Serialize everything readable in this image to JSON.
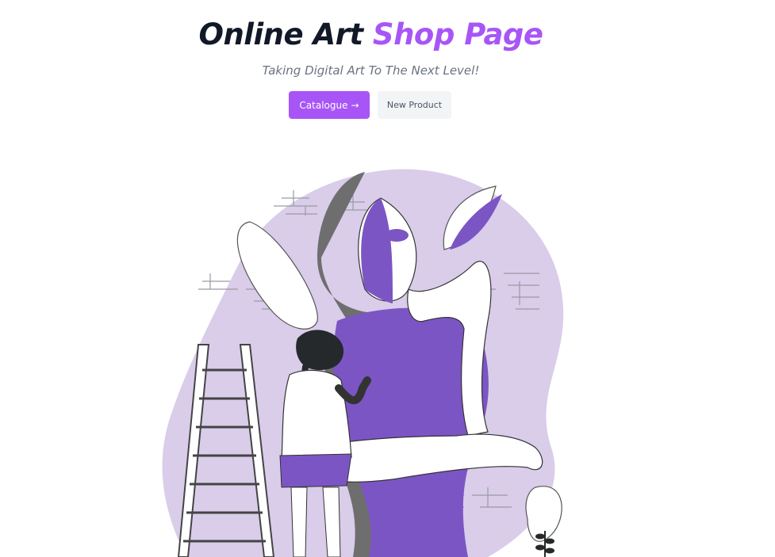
{
  "hero": {
    "title_part1": "Online Art",
    "title_part2": "Shop Page",
    "subtitle": "Taking Digital Art To The Next Level!"
  },
  "buttons": {
    "catalogue_label": "Catalogue",
    "catalogue_icon": "→",
    "new_product_label": "New Product"
  },
  "colors": {
    "accent": "#a855f7",
    "title_dark": "#111827",
    "subtitle": "#6b7280",
    "secondary_button_bg": "#f3f4f6",
    "illustration_lavender": "#d9cdea",
    "illustration_purple": "#7c55c4",
    "illustration_gray": "#6e6e6e"
  },
  "illustration": {
    "icon_name": "woman-painting-mural-illustration"
  }
}
